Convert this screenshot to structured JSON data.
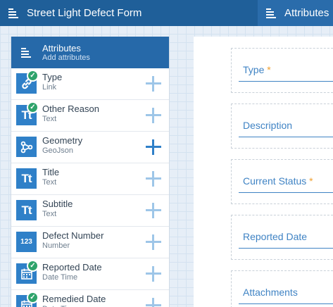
{
  "header": {
    "form_title": "Street Light Defect Form",
    "attributes_tab": "Attributes"
  },
  "panel": {
    "title": "Attributes",
    "subtitle": "Add attributes",
    "items": [
      {
        "name": "Type",
        "type": "Link",
        "icon": "link-icon",
        "checked": true
      },
      {
        "name": "Other Reason",
        "type": "Text",
        "icon": "text-icon",
        "checked": true
      },
      {
        "name": "Geometry",
        "type": "GeoJson",
        "icon": "geometry-icon",
        "checked": false
      },
      {
        "name": "Title",
        "type": "Text",
        "icon": "text-icon",
        "checked": false
      },
      {
        "name": "Subtitle",
        "type": "Text",
        "icon": "text-icon",
        "checked": false
      },
      {
        "name": "Defect Number",
        "type": "Number",
        "icon": "number-icon",
        "icon_text": "123",
        "checked": false
      },
      {
        "name": "Reported Date",
        "type": "Date Time",
        "icon": "calendar-icon",
        "checked": true
      },
      {
        "name": "Remedied Date",
        "type": "Date Time",
        "icon": "calendar-icon",
        "checked": true
      }
    ]
  },
  "form": {
    "fields": [
      {
        "label": "Type",
        "required": true
      },
      {
        "label": "Description",
        "required": false
      },
      {
        "label": "Current Status",
        "required": true
      },
      {
        "label": "Reported Date",
        "required": false
      },
      {
        "label": "Attachments",
        "required": false
      }
    ],
    "required_marker": "*"
  },
  "colors": {
    "header_bg": "#1f5f99",
    "accent": "#2f80c8",
    "check_green": "#2ea36b",
    "required": "#f0a030"
  }
}
